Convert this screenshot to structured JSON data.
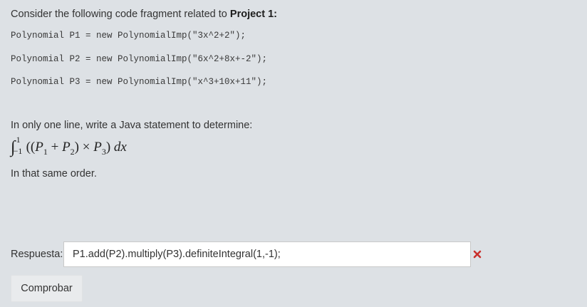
{
  "question": {
    "intro_text": "Consider the following code fragment related to ",
    "intro_bold": "Project 1:",
    "code_lines": [
      "Polynomial P1 = new PolynomialImp(\"3x^2+2\");",
      "Polynomial P2 = new PolynomialImp(\"6x^2+8x+-2\");",
      "Polynomial P3 = new PolynomialImp(\"x^3+10x+11\");"
    ],
    "instruction": "In only one line, write a Java statement to determine:",
    "formula": {
      "integral_sign": "∫",
      "upper_limit": "1",
      "lower_limit": "−1",
      "open": "((",
      "p1": "P",
      "p1_sub": "1",
      "plus": " + ",
      "p2": "P",
      "p2_sub": "2",
      "close_times": ") × ",
      "p3": "P",
      "p3_sub": "3",
      "close": ") ",
      "dx": "dx"
    },
    "order_note": "In that same order."
  },
  "answer": {
    "label": "Respuesta:",
    "value": "P1.add(P2).multiply(P3).definiteIntegral(1,-1);",
    "status_icon": "incorrect-x-icon",
    "status_color": "#c9302c"
  },
  "actions": {
    "check_label": "Comprobar"
  }
}
